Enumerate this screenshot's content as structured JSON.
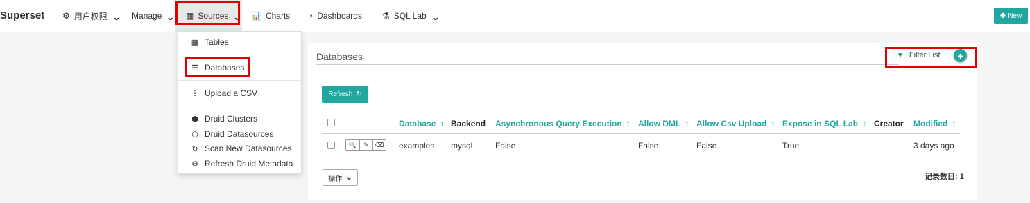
{
  "brand": "Superset",
  "nav": {
    "items": [
      {
        "label": "用户权限",
        "icon": "cogs-icon"
      },
      {
        "label": "Manage"
      },
      {
        "label": "Sources",
        "icon": "table-icon"
      },
      {
        "label": "Charts",
        "icon": "bar-chart-icon"
      },
      {
        "label": "Dashboards",
        "icon": "dashboard-icon"
      },
      {
        "label": "SQL Lab",
        "icon": "flask-icon"
      }
    ],
    "new_label": "New"
  },
  "sources_menu": {
    "items": [
      {
        "label": "Tables",
        "icon": "table-icon"
      },
      {
        "label": "Databases",
        "icon": "database-icon"
      },
      {
        "label": "Upload a CSV",
        "icon": "upload-icon"
      },
      {
        "label": "Druid Clusters",
        "icon": "cubes-icon"
      },
      {
        "label": "Druid Datasources",
        "icon": "cube-icon"
      },
      {
        "label": "Scan New Datasources",
        "icon": "refresh-icon"
      },
      {
        "label": "Refresh Druid Metadata",
        "icon": "cog-icon"
      }
    ]
  },
  "panel": {
    "title": "Databases",
    "filter_label": "Filter List",
    "refresh_label": "Refresh",
    "columns": [
      "Database",
      "Backend",
      "Asynchronous Query Execution",
      "Allow DML",
      "Allow Csv Upload",
      "Expose in SQL Lab",
      "Creator",
      "Modified"
    ],
    "rows": [
      {
        "database": "examples",
        "backend": "mysql",
        "async": "False",
        "allow_dml": "False",
        "allow_csv": "False",
        "expose_sqllab": "True",
        "creator": "",
        "modified": "3 days ago"
      }
    ],
    "ops_label": "操作",
    "record_count": "记录数目: 1"
  },
  "colors": {
    "accent": "#20a7a0",
    "highlight": "#e00000"
  }
}
